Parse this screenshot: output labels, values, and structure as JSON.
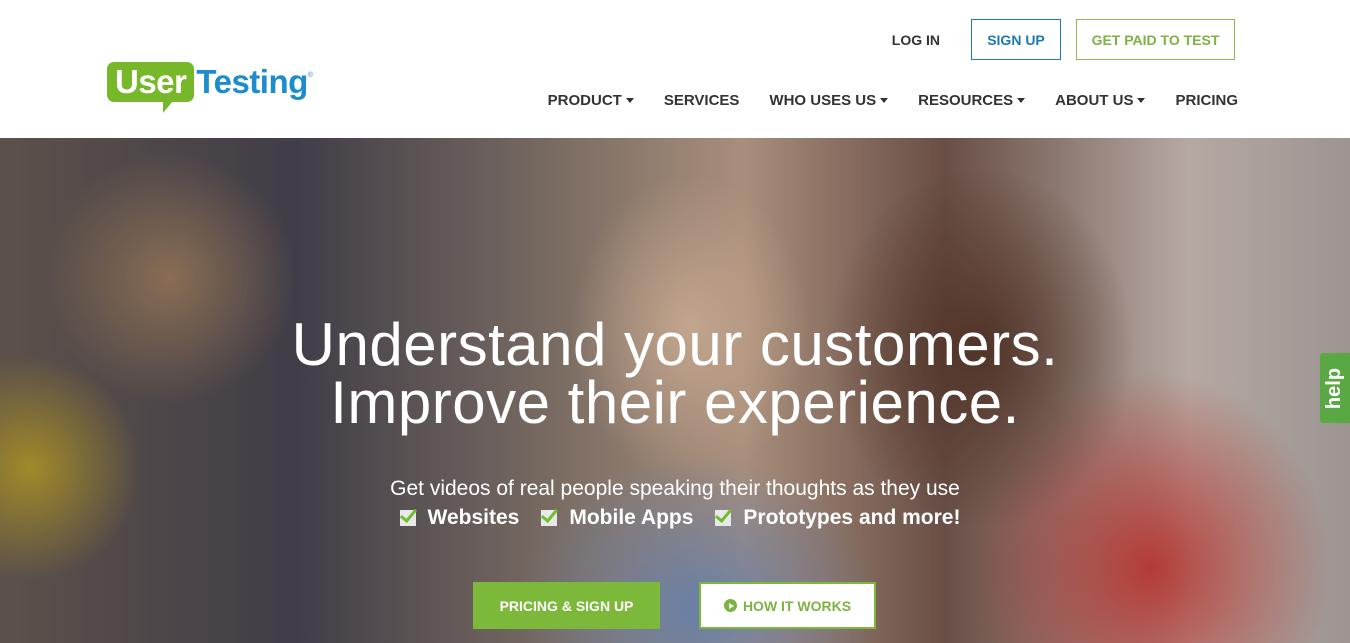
{
  "header": {
    "logo": {
      "part1": "User",
      "part2": "Testing",
      "reg": "®"
    },
    "top_links": {
      "login": "LOG IN",
      "signup": "SIGN UP",
      "get_paid": "GET PAID TO TEST"
    },
    "nav": [
      {
        "label": "PRODUCT",
        "dropdown": true
      },
      {
        "label": "SERVICES",
        "dropdown": false
      },
      {
        "label": "WHO USES US",
        "dropdown": true
      },
      {
        "label": "RESOURCES",
        "dropdown": true
      },
      {
        "label": "ABOUT US",
        "dropdown": true
      },
      {
        "label": "PRICING",
        "dropdown": false
      }
    ]
  },
  "hero": {
    "title_line1": "Understand your customers.",
    "title_line2": "Improve their experience.",
    "subtitle": "Get videos of real people speaking their thoughts as they use",
    "features": [
      "Websites",
      "Mobile Apps",
      "Prototypes and more!"
    ],
    "primary_cta": "PRICING & SIGN UP",
    "secondary_cta": "HOW IT WORKS",
    "help_tab": "help"
  },
  "colors": {
    "brand_green": "#76b82a",
    "brand_blue": "#1b8ccc",
    "signup_blue": "#1f79b1",
    "help_green": "#5aa844"
  }
}
